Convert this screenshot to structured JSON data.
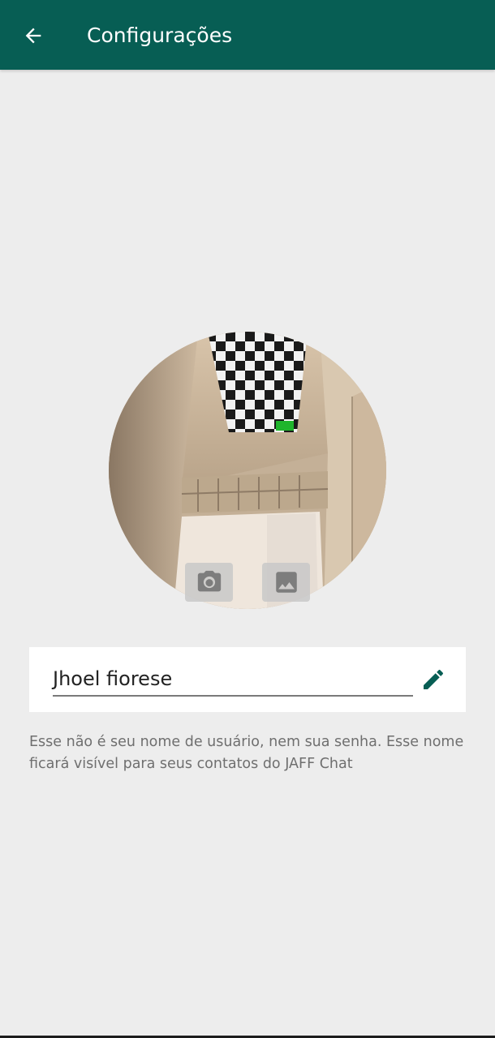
{
  "appbar": {
    "title": "Configurações",
    "back_icon": "arrow-back-icon",
    "background_color": "#075e54"
  },
  "profile": {
    "photo_icon_buttons": [
      "camera-icon",
      "image-icon"
    ],
    "name_value": "Jhoel fiorese",
    "edit_icon": "pencil-icon",
    "hint_text": "Esse não é seu nome de usuário, nem sua senha. Esse nome ficará visível para seus contatos do JAFF Chat"
  },
  "colors": {
    "accent": "#075e54",
    "page_background": "#ededed",
    "hint_text": "#6f6f6f"
  }
}
